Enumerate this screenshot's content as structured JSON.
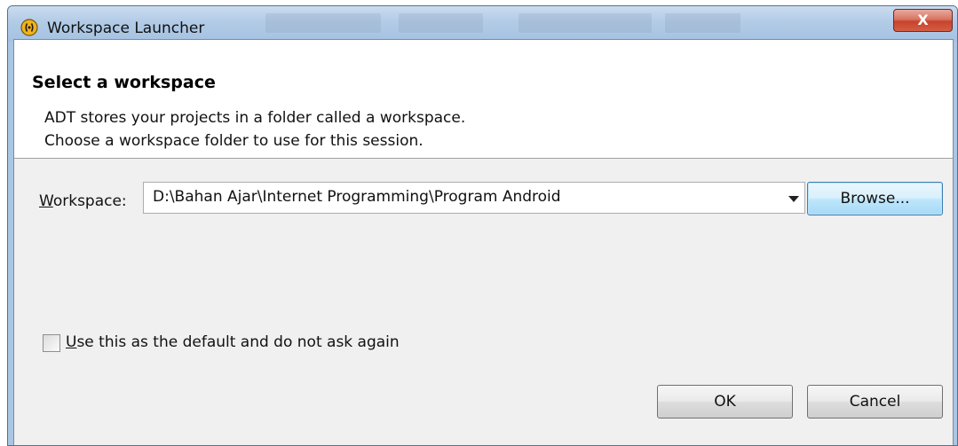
{
  "window": {
    "title": "Workspace Launcher",
    "close_label": "X"
  },
  "banner": {
    "title": "Select a workspace",
    "line1": "ADT stores your projects in a folder called a workspace.",
    "line2": "Choose a workspace folder to use for this session."
  },
  "workspace": {
    "label_mnemonic": "W",
    "label_rest": "orkspace:",
    "value": "D:\\Bahan Ajar\\Internet Programming\\Program Android",
    "browse_label": "Browse..."
  },
  "default_checkbox": {
    "label_mnemonic": "U",
    "label_rest": "se this as the default and do not ask again",
    "checked": false
  },
  "buttons": {
    "ok_label": "OK",
    "cancel_label": "Cancel"
  },
  "colors": {
    "app_icon": "#f2b21b",
    "close_button": "#c7432b",
    "title_bar": "#b2cbe6"
  }
}
